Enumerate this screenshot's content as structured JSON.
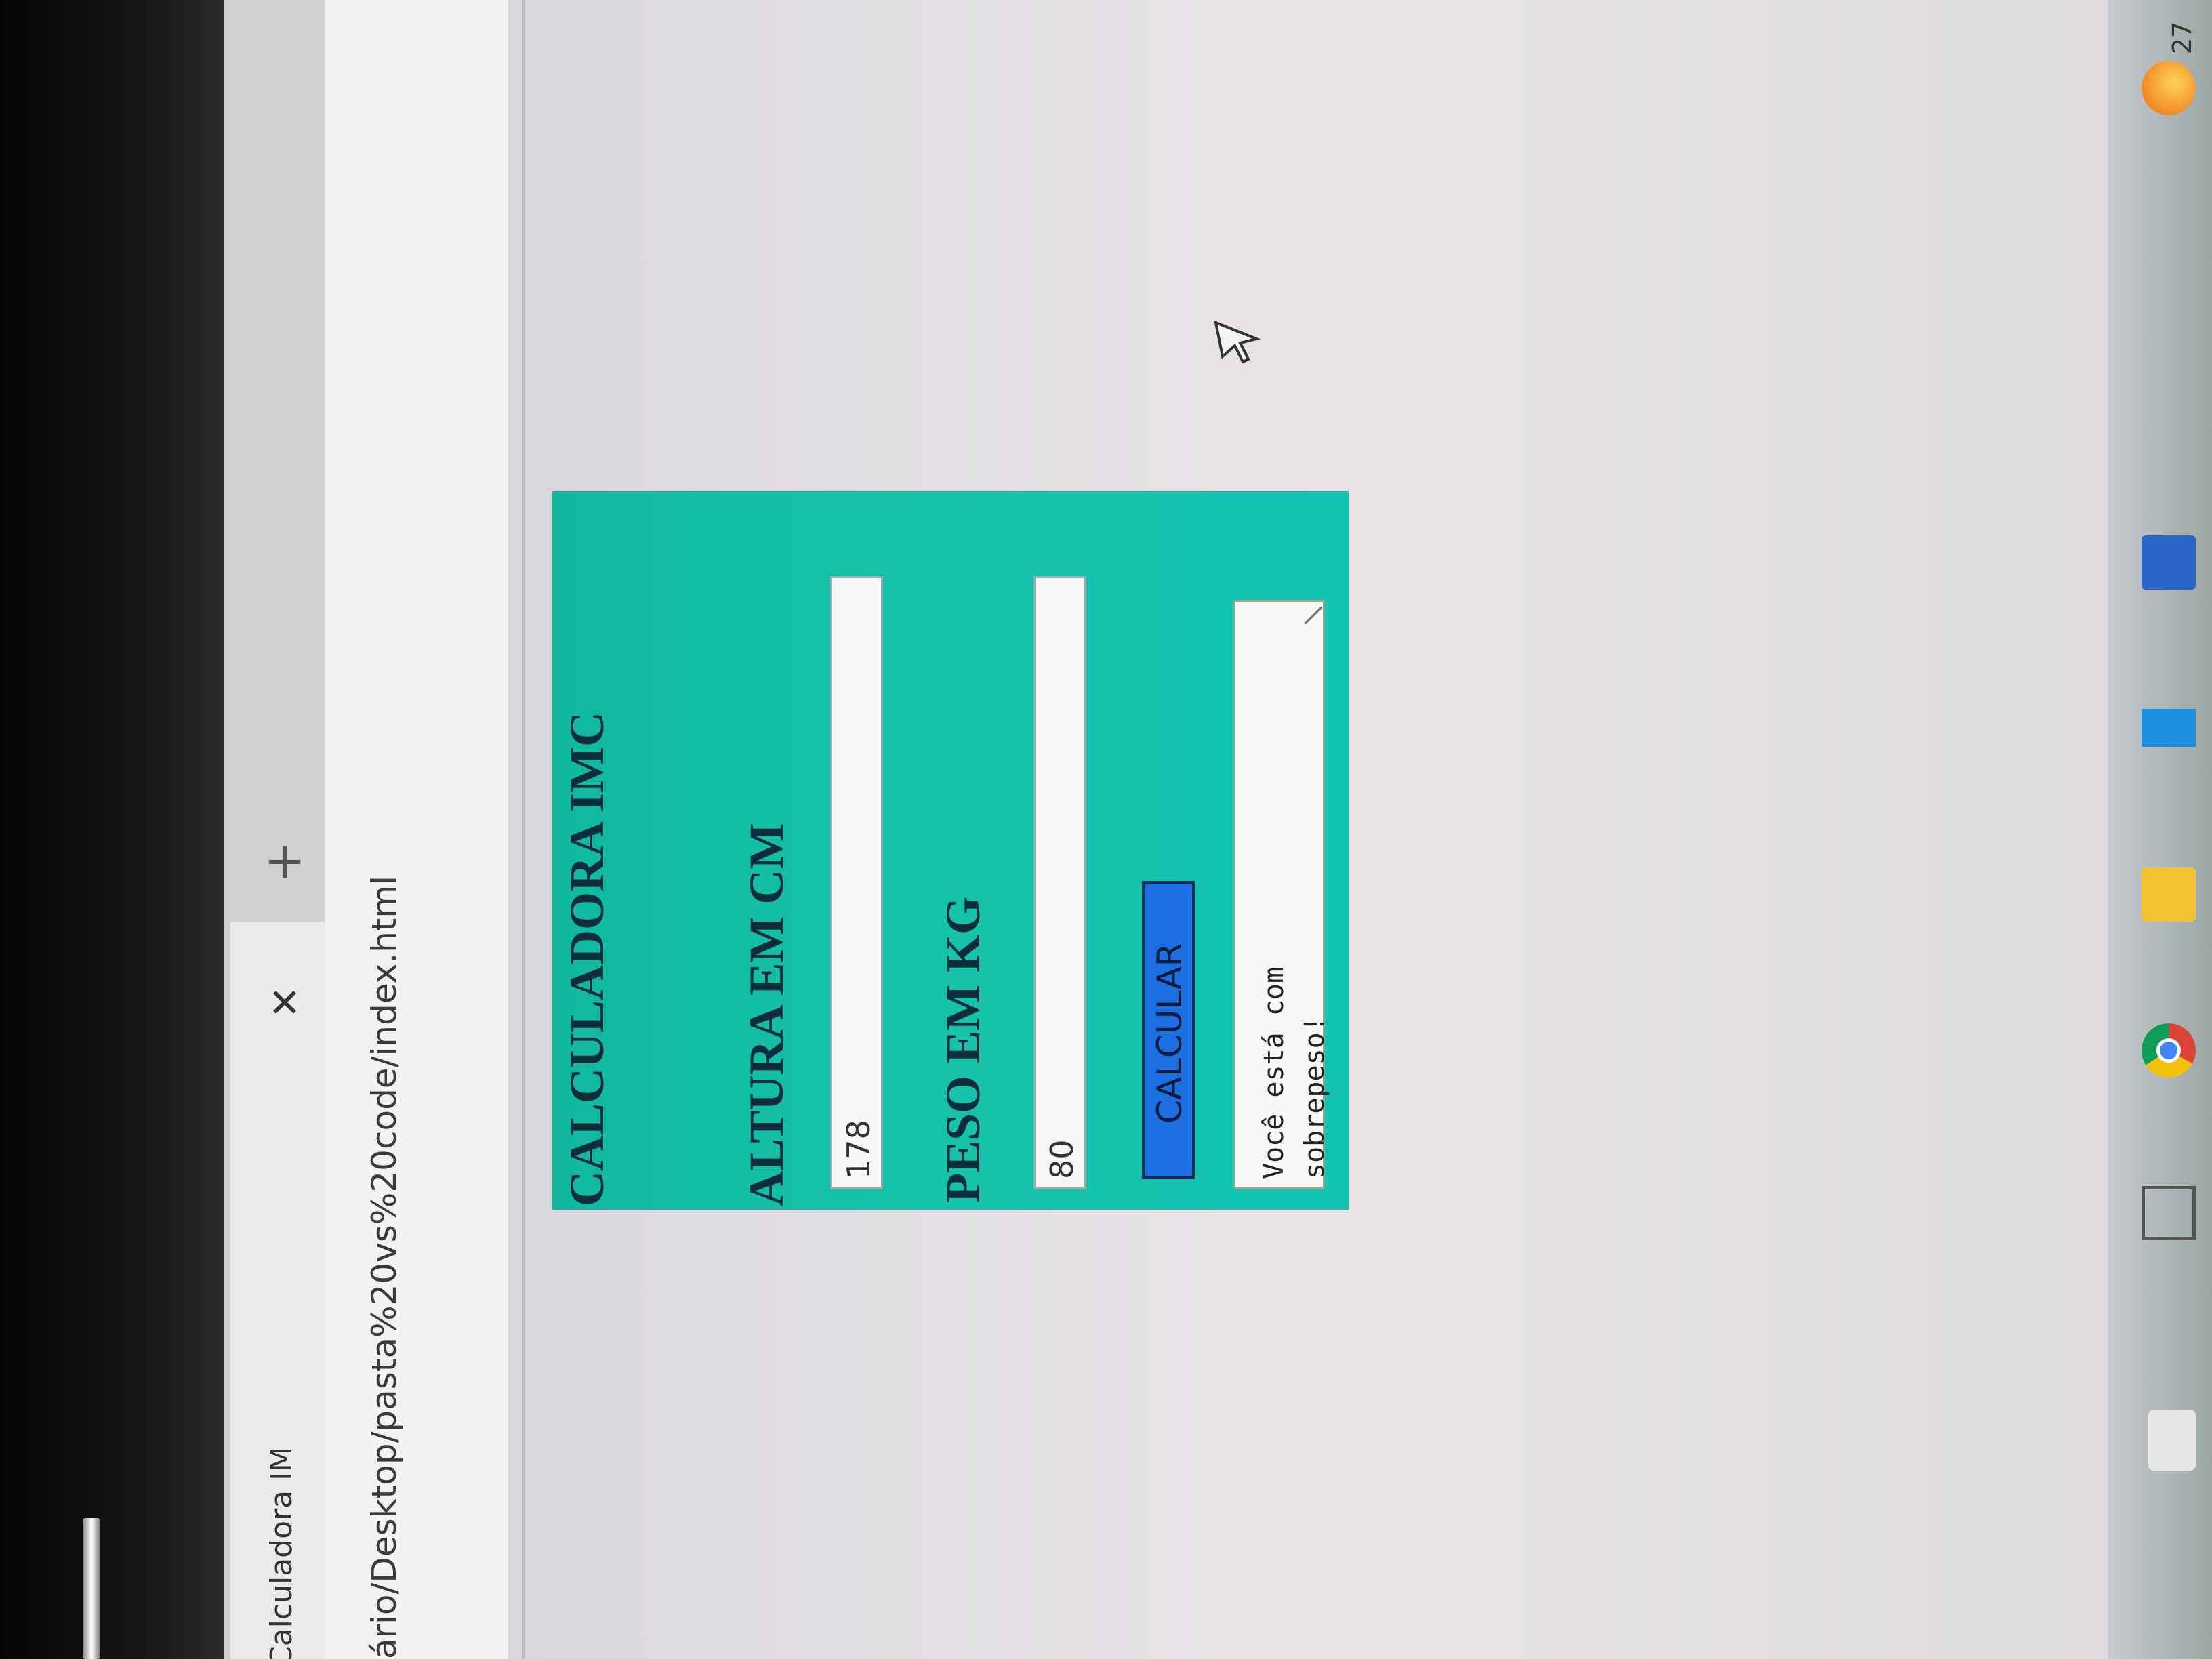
{
  "browser": {
    "tab_title": "Calculadora IMC",
    "close_symbol": "✕",
    "new_tab_symbol": "+",
    "url": "ário/Desktop/pasta%20vs%20code/index.html"
  },
  "app": {
    "title": "CALCULADORA IMC",
    "altura_label": "ALTURA EM CM",
    "altura_value": "178",
    "peso_label": "PESO EM KG",
    "peso_value": "80",
    "calcular_label": "CALCULAR",
    "result_text": "Você está com sobrepeso!"
  },
  "taskbar": {
    "clock": "27"
  },
  "colors": {
    "card_bg": "#14c0a8",
    "button_bg": "#1b6fe0",
    "title_text": "#0b2e3a"
  }
}
